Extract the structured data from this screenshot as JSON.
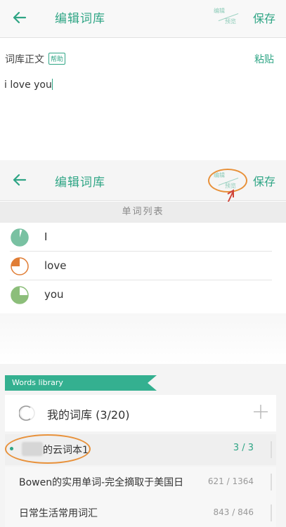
{
  "editor_screen": {
    "header": {
      "title": "编辑词库",
      "toggle_top": "编辑",
      "toggle_bottom": "预览",
      "save_label": "保存"
    },
    "body_label": "词库正文",
    "help_label": "帮助",
    "paste_label": "粘贴",
    "content": "i love you"
  },
  "preview_screen": {
    "header": {
      "title": "编辑词库",
      "toggle_top": "编辑",
      "toggle_bottom": "预览",
      "save_label": "保存"
    },
    "list_title": "单词列表",
    "words": [
      {
        "text": "I",
        "progress": 0.05,
        "color": "#79c1a2"
      },
      {
        "text": "love",
        "progress": 0.75,
        "color": "#e07d35"
      },
      {
        "text": "you",
        "progress": 0.25,
        "color": "#8cbe7a"
      }
    ]
  },
  "library_screen": {
    "ribbon_label": "Words library",
    "library_title": "我的词库 (3/20)",
    "items": [
      {
        "name": "的云词本1",
        "count": "3 / 3"
      },
      {
        "name": "Bowen的实用单词-完全摘取于美国日",
        "count": "621 / 1364"
      },
      {
        "name": "日常生活常用词汇",
        "count": "843 / 846"
      }
    ]
  },
  "colors": {
    "accent": "#2fa585",
    "annotation": "#e8913a"
  }
}
